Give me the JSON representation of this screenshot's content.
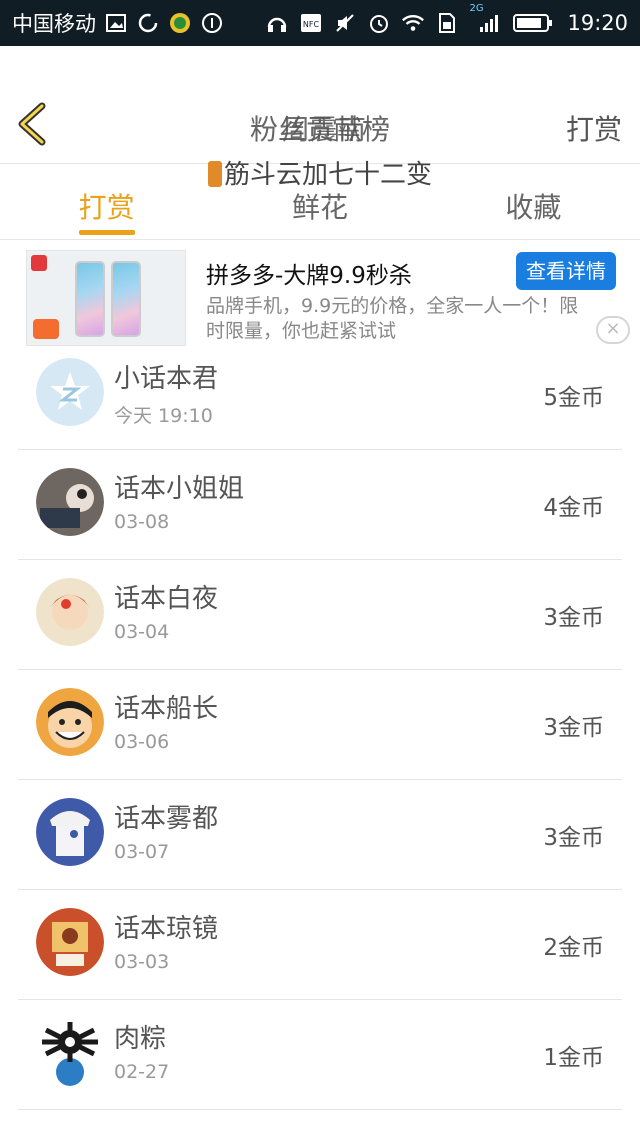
{
  "status_bar": {
    "carrier": "中国移动",
    "network": "2G",
    "time": "19:20"
  },
  "header": {
    "title": "粉丝贡献榜",
    "overlay_text": "周震南",
    "subtitle": "筋斗云加七十二变",
    "right_action": "打赏"
  },
  "tabs": [
    {
      "label": "打赏",
      "active": true
    },
    {
      "label": "鲜花",
      "active": false
    },
    {
      "label": "收藏",
      "active": false
    }
  ],
  "ad": {
    "title": "拼多多-大牌9.9秒杀",
    "description": "品牌手机，9.9元的价格，全家一人一个！限时限量，你也赶紧试试",
    "button_label": "查看详情",
    "close_label": "×"
  },
  "rows": [
    {
      "name": "小话本君",
      "date": "今天 19:10",
      "coins": "5金币",
      "avatar_color": "#cfe4f0"
    },
    {
      "name": "话本小姐姐",
      "date": "03-08",
      "coins": "4金币",
      "avatar_color": "#8a7d78"
    },
    {
      "name": "话本白夜",
      "date": "03-04",
      "coins": "3金币",
      "avatar_color": "#e6c8a4"
    },
    {
      "name": "话本船长",
      "date": "03-06",
      "coins": "3金币",
      "avatar_color": "#e59a3c"
    },
    {
      "name": "话本雾都",
      "date": "03-07",
      "coins": "3金币",
      "avatar_color": "#4a64b2"
    },
    {
      "name": "话本琼镜",
      "date": "03-03",
      "coins": "2金币",
      "avatar_color": "#d2572a"
    },
    {
      "name": "肉粽",
      "date": "02-27",
      "coins": "1金币",
      "avatar_color": "#2c7dc4"
    }
  ]
}
